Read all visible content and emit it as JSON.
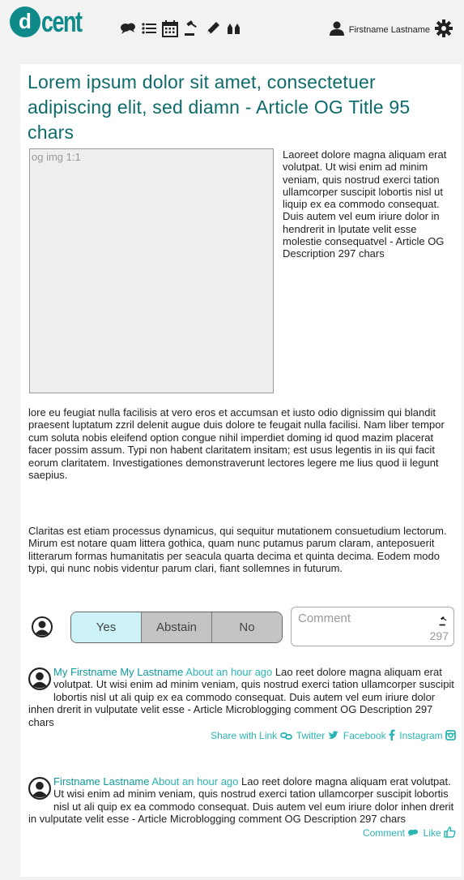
{
  "header": {
    "logo_text": "cent",
    "logo_letter": "d",
    "nav_icons": [
      "speech-bubbles-icon",
      "list-icon",
      "calendar-icon",
      "gavel-icon",
      "pencil-icon",
      "hands-icon"
    ],
    "user_name": "Firstname Lastname",
    "settings_icon": "gear-icon"
  },
  "article": {
    "title": "Lorem ipsum dolor sit amet, consectetuer adipiscing elit, sed diamn - Article OG Title 95 chars",
    "image_placeholder": "og img 1:1",
    "description_right": "Laoreet dolore magna aliquam erat volutpat. Ut wisi enim ad minim veniam, quis nostrud exerci tation  ullamcorper suscipit lobortis nisl ut liquip ex ea commodo consequat. Duis autem vel eum iriure dolor in hendrerit in lputate velit esse molestie consequatvel - Article OG Description 297 chars",
    "description_continued": "lore eu feugiat nulla facilisis at vero eros et accumsan et iusto odio dignissim qui blandit praesent luptatum zzril delenit augue duis dolore te feugait nulla facilisi. Nam liber tempor cum soluta nobis eleifend option congue nihil imperdiet doming id quod mazim placerat facer possim assum. Typi non habent claritatem insitam; est usus legentis in iis qui facit eorum claritatem. Investigationes demonstraverunt lectores legere me lius quod ii legunt saepius.",
    "paragraph2": "Claritas est etiam processus dynamicus, qui sequitur mutationem consuetudium lectorum. Mirum est notare quam littera gothica, quam nunc putamus parum claram, anteposuerit litterarum formas humanitatis per seacula quarta decima et quinta decima. Eodem modo typi, qui nunc nobis videntur parum clari, fiant sollemnes in futurum."
  },
  "vote": {
    "options": [
      "Yes",
      "Abstain",
      "No"
    ],
    "selected": "Yes",
    "comment_placeholder": "Comment",
    "char_count": "297"
  },
  "comments": [
    {
      "author": "My Firstname My Lastname",
      "time": "About an hour ago",
      "text": "Lao reet dolore magna aliquam erat volutpat. Ut wisi enim ad minim veniam, quis nostrud exerci tation ullamcorper suscipit lobortis nisl ut ali quip ex ea commodo consequat. Duis autem vel eum iriure dolor inhen drerit in vulputate velit esse - Article Microblogging comment OG Description 297 chars",
      "actions": {
        "share_link": "Share with Link",
        "twitter": "Twitter",
        "facebook": "Facebook",
        "instagram": "Instagram"
      }
    },
    {
      "author": "Firstname Lastname",
      "time": "About an hour ago",
      "text": "Lao reet dolore magna aliquam erat volutpat. Ut wisi enim ad minim veniam, quis nostrud exerci tation ullamcorper suscipit lobortis nisl ut ali quip ex ea commodo consequat. Duis autem vel eum iriure dolor inhen drerit in vulputate velit esse - Article Microblogging comment OG Description 297 chars",
      "actions": {
        "comment": "Comment",
        "like": "Like"
      }
    }
  ],
  "colors": {
    "brand": "#0e8a8a",
    "title": "#0d6b6b",
    "link": "#2ab5b5",
    "yes_bg": "#cdf3f8",
    "vote_bg": "#c4c4c4"
  }
}
